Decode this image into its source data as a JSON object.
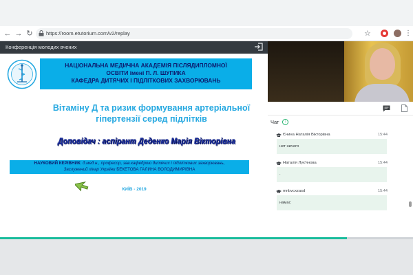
{
  "browser": {
    "url": "https://room.etutorium.com/v2/replay"
  },
  "app": {
    "title": "Конференція молодих вчених"
  },
  "slide": {
    "banner_lines": [
      "НАЦІОНАЛЬНА МЕДИЧНА АКАДЕМІЯ ПІСЛЯДИПЛОМНОЇ",
      "ОСВІТИ імені П. Л. ШУПИКА",
      "КАФЕДРА ДИТЯЧИХ І ПІДЛІТКОВИХ ЗАХВОРЮВАНЬ"
    ],
    "title_line1": "Вітаміну Д та ризик формування артеріальної",
    "title_line2": "гіпертензії серед підлітків",
    "speaker": "Доповідач : аспірант Деденко Марія Вікторівна",
    "supervisor": {
      "line1_bold": "НАУКОВИЙ КЕРІВНИК",
      "line1_rest": ": д.мед.н., професор, зав.кафедрою дитячих і підліткових захворювань,",
      "line2_italic": "Заслужений лікар України",
      "line2_rest": " БЕКЕТОВА ГАЛИНА ВОЛОДИМИРІВНА"
    },
    "city_year": "КИЇВ - 2019"
  },
  "progress": {
    "fraction": 0.84
  },
  "chat": {
    "label": "Чат",
    "messages": [
      {
        "author": "Єчина Наталія Вікторівна",
        "time": "15:44",
        "text": "нет ничего"
      },
      {
        "author": "Наталія Лук'янова",
        "time": "15:44",
        "text": "."
      },
      {
        "author": "mnbvcxzasd",
        "time": "15:44",
        "text": "намас"
      }
    ]
  },
  "colors": {
    "banner_blue": "#0aaee8",
    "title_blue": "#27a9e1",
    "speaker_blue": "#1c2fa0",
    "progress_green": "#1abc9c",
    "header_dark": "#343a40"
  },
  "icons": {
    "back": "arrow-left-icon",
    "forward": "arrow-right-icon",
    "reload": "reload-icon",
    "lock": "lock-icon",
    "star": "star-icon",
    "exit": "exit-icon",
    "chat_tab": "chat-bubble-icon",
    "files_tab": "file-icon",
    "cursor": "arrow-cursor-icon"
  }
}
